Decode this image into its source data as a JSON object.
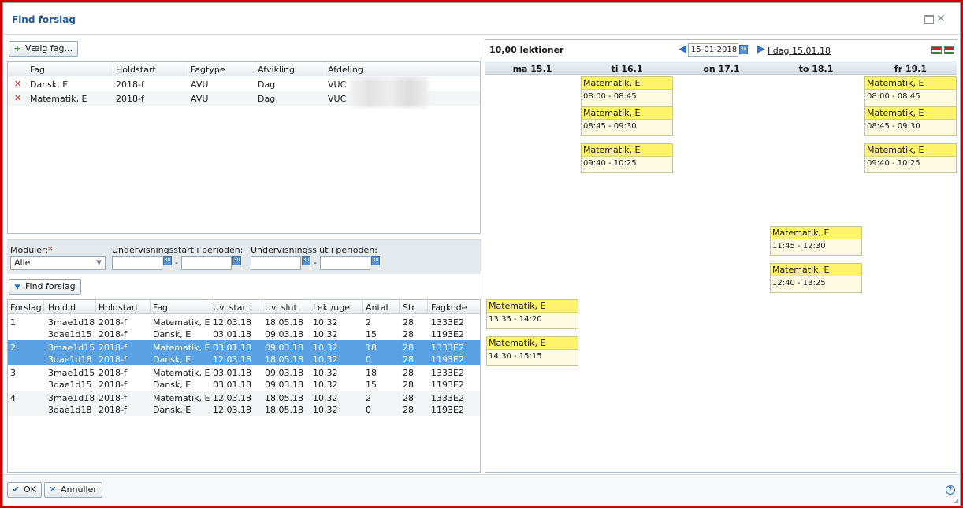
{
  "dialog": {
    "title": "Find forslag"
  },
  "left": {
    "add_button": "Vælg fag...",
    "subjects_table": {
      "columns": [
        "Fag",
        "Holdstart",
        "Fagtype",
        "Afvikling",
        "Afdeling"
      ],
      "rows": [
        {
          "fag": "Dansk, E",
          "holdstart": "2018-f",
          "fagtype": "AVU",
          "afvikling": "Dag",
          "afdeling": "VUC"
        },
        {
          "fag": "Matematik, E",
          "holdstart": "2018-f",
          "fagtype": "AVU",
          "afvikling": "Dag",
          "afdeling": "VUC"
        }
      ]
    },
    "filters": {
      "moduler_label": "Moduler:",
      "moduler_value": "Alle",
      "start_label": "Undervisningsstart i perioden:",
      "end_label": "Undervisningsslut i perioden:",
      "dash": "-"
    },
    "find_button": "Find forslag",
    "results_table": {
      "columns": [
        "Forslag",
        "Holdid",
        "Holdstart",
        "Fag",
        "Uv. start",
        "Uv. slut",
        "Lek./uge",
        "Antal",
        "Str",
        "Fagkode"
      ],
      "groups": [
        {
          "forslag": "1",
          "rows": [
            {
              "holdid": "3mae1d18",
              "holdstart": "2018-f",
              "fag": "Matematik, E",
              "start": "12.03.18",
              "slut": "18.05.18",
              "lek": "10,32",
              "antal": "2",
              "str": "28",
              "fagkode": "1333E2"
            },
            {
              "holdid": "3dae1d15",
              "holdstart": "2018-f",
              "fag": "Dansk, E",
              "start": "03.01.18",
              "slut": "09.03.18",
              "lek": "10,32",
              "antal": "15",
              "str": "28",
              "fagkode": "1193E2"
            }
          ]
        },
        {
          "forslag": "2",
          "rows": [
            {
              "holdid": "3mae1d15",
              "holdstart": "2018-f",
              "fag": "Matematik, E",
              "start": "03.01.18",
              "slut": "09.03.18",
              "lek": "10,32",
              "antal": "18",
              "str": "28",
              "fagkode": "1333E2"
            },
            {
              "holdid": "3dae1d18",
              "holdstart": "2018-f",
              "fag": "Dansk, E",
              "start": "12.03.18",
              "slut": "18.05.18",
              "lek": "10,32",
              "antal": "0",
              "str": "28",
              "fagkode": "1193E2"
            }
          ]
        },
        {
          "forslag": "3",
          "rows": [
            {
              "holdid": "3mae1d15",
              "holdstart": "2018-f",
              "fag": "Matematik, E",
              "start": "03.01.18",
              "slut": "09.03.18",
              "lek": "10,32",
              "antal": "18",
              "str": "28",
              "fagkode": "1333E2"
            },
            {
              "holdid": "3dae1d15",
              "holdstart": "2018-f",
              "fag": "Dansk, E",
              "start": "03.01.18",
              "slut": "09.03.18",
              "lek": "10,32",
              "antal": "15",
              "str": "28",
              "fagkode": "1193E2"
            }
          ]
        },
        {
          "forslag": "4",
          "rows": [
            {
              "holdid": "3mae1d18",
              "holdstart": "2018-f",
              "fag": "Matematik, E",
              "start": "12.03.18",
              "slut": "18.05.18",
              "lek": "10,32",
              "antal": "2",
              "str": "28",
              "fagkode": "1333E2"
            },
            {
              "holdid": "3dae1d18",
              "holdstart": "2018-f",
              "fag": "Dansk, E",
              "start": "12.03.18",
              "slut": "18.05.18",
              "lek": "10,32",
              "antal": "0",
              "str": "28",
              "fagkode": "1193E2"
            }
          ]
        }
      ]
    }
  },
  "calendar": {
    "lektioner": "10,00 lektioner",
    "date_value": "15-01-2018",
    "today_label": "I dag",
    "today_date": "15.01.18",
    "days": [
      "ma 15.1",
      "ti 16.1",
      "on 17.1",
      "to 18.1",
      "fr 19.1"
    ],
    "events": [
      {
        "day": 1,
        "title": "Matematik, E",
        "time": "08:00 - 08:45"
      },
      {
        "day": 1,
        "title": "Matematik, E",
        "time": "08:45 - 09:30"
      },
      {
        "day": 1,
        "title": "Matematik, E",
        "time": "09:40 - 10:25"
      },
      {
        "day": 4,
        "title": "Matematik, E",
        "time": "08:00 - 08:45"
      },
      {
        "day": 4,
        "title": "Matematik, E",
        "time": "08:45 - 09:30"
      },
      {
        "day": 4,
        "title": "Matematik, E",
        "time": "09:40 - 10:25"
      },
      {
        "day": 3,
        "title": "Matematik, E",
        "time": "11:45 - 12:30"
      },
      {
        "day": 3,
        "title": "Matematik, E",
        "time": "12:40 - 13:25"
      },
      {
        "day": 0,
        "title": "Matematik, E",
        "time": "13:35 - 14:20"
      },
      {
        "day": 0,
        "title": "Matematik, E",
        "time": "14:30 - 15:15"
      }
    ]
  },
  "footer": {
    "ok": "OK",
    "cancel": "Annuller"
  }
}
